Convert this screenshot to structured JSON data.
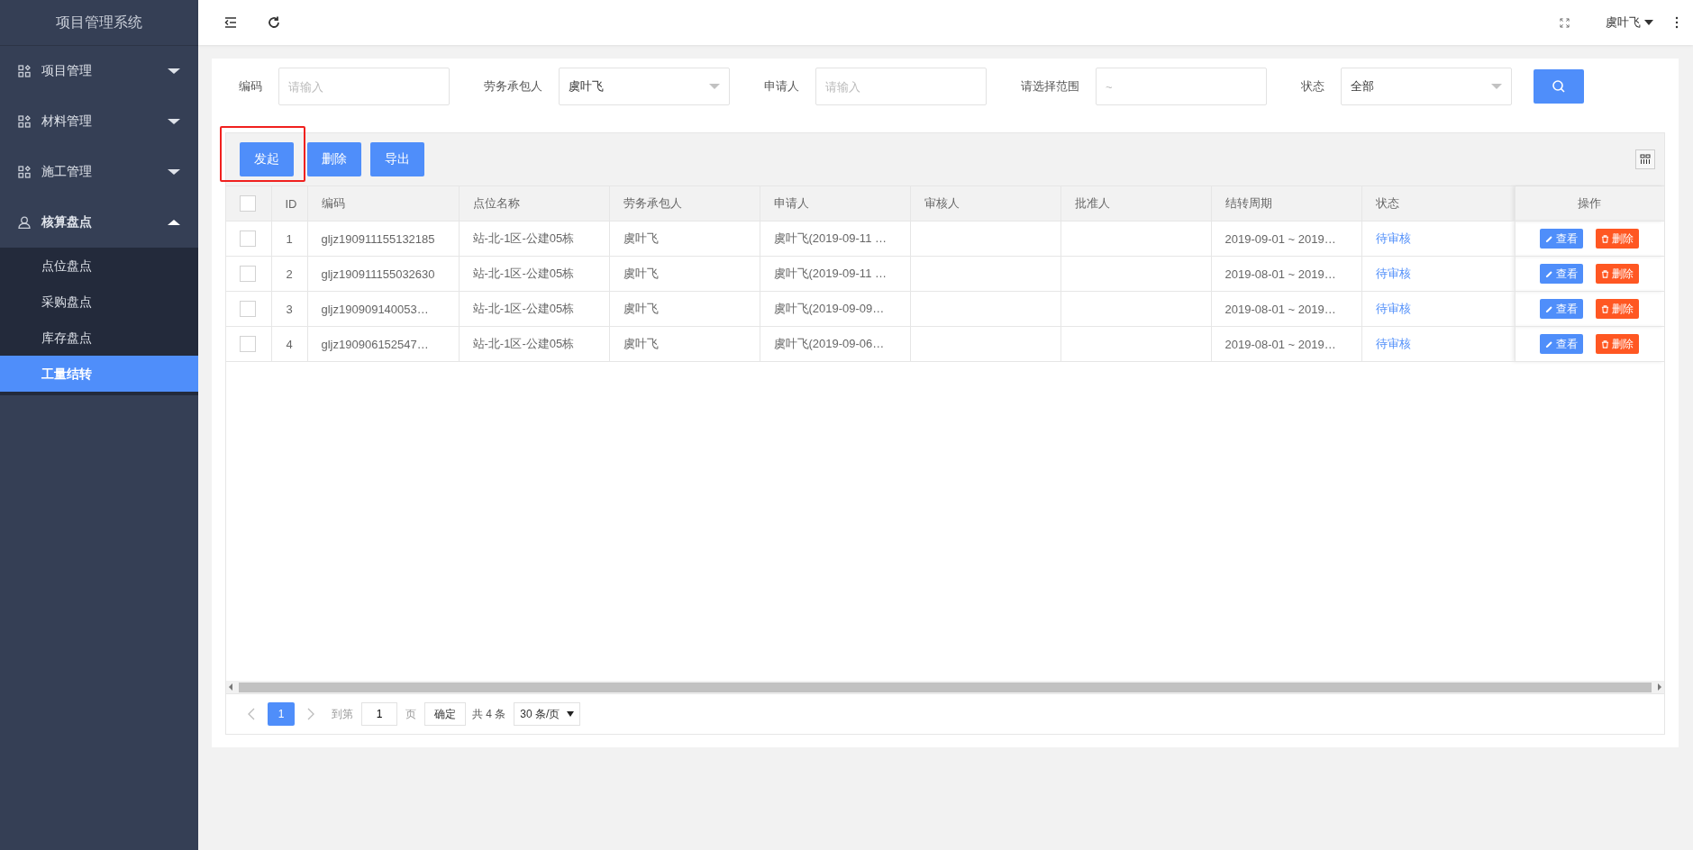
{
  "app_title": "项目管理系统",
  "sidebar": {
    "menu": [
      {
        "label": "项目管理",
        "expanded": false
      },
      {
        "label": "材料管理",
        "expanded": false
      },
      {
        "label": "施工管理",
        "expanded": false
      },
      {
        "label": "核算盘点",
        "expanded": true,
        "children": [
          {
            "label": "点位盘点",
            "selected": false
          },
          {
            "label": "采购盘点",
            "selected": false
          },
          {
            "label": "库存盘点",
            "selected": false
          },
          {
            "label": "工量结转",
            "selected": true
          }
        ]
      }
    ]
  },
  "topbar": {
    "user": "虞叶飞"
  },
  "filters": [
    {
      "kind": "input",
      "label": "编码",
      "placeholder": "请输入"
    },
    {
      "kind": "select",
      "label": "劳务承包人",
      "value": "虞叶飞"
    },
    {
      "kind": "input",
      "label": "申请人",
      "placeholder": "请输入"
    },
    {
      "kind": "input",
      "label": "请选择范围",
      "placeholder": "~"
    },
    {
      "kind": "select",
      "label": "状态",
      "value": "全部"
    }
  ],
  "toolbar": {
    "buttons": [
      {
        "label": "发起",
        "highlighted": true
      },
      {
        "label": "删除",
        "highlighted": false
      },
      {
        "label": "导出",
        "highlighted": false
      }
    ]
  },
  "table": {
    "all_checked": false,
    "columns": [
      "ID",
      "编码",
      "点位名称",
      "劳务承包人",
      "申请人",
      "审核人",
      "批准人",
      "结转周期",
      "状态",
      "操作"
    ],
    "rows": [
      {
        "checked": false,
        "id": "1",
        "code": "gljz190911155132185",
        "location": "站-北-1区-公建05栋",
        "contractor": "虞叶飞",
        "applicant": "虞叶飞(2019-09-11 …",
        "period": "2019-09-01 ~ 2019…",
        "status": "待审核",
        "actions": [
          {
            "kind": "view",
            "label": "查看"
          },
          {
            "kind": "delete",
            "label": "删除"
          }
        ]
      },
      {
        "checked": false,
        "id": "2",
        "code": "gljz190911155032630",
        "location": "站-北-1区-公建05栋",
        "contractor": "虞叶飞",
        "applicant": "虞叶飞(2019-09-11 …",
        "period": "2019-08-01 ~ 2019…",
        "status": "待审核",
        "actions": [
          {
            "kind": "view",
            "label": "查看"
          },
          {
            "kind": "delete",
            "label": "删除"
          }
        ]
      },
      {
        "checked": false,
        "id": "3",
        "code": "gljz190909140053…",
        "location": "站-北-1区-公建05栋",
        "contractor": "虞叶飞",
        "applicant": "虞叶飞(2019-09-09…",
        "period": "2019-08-01 ~ 2019…",
        "status": "待审核",
        "actions": [
          {
            "kind": "view",
            "label": "查看"
          },
          {
            "kind": "delete",
            "label": "删除"
          }
        ]
      },
      {
        "checked": false,
        "id": "4",
        "code": "gljz190906152547…",
        "location": "站-北-1区-公建05栋",
        "contractor": "虞叶飞",
        "applicant": "虞叶飞(2019-09-06…",
        "period": "2019-08-01 ~ 2019…",
        "status": "待审核",
        "actions": [
          {
            "kind": "view",
            "label": "查看"
          },
          {
            "kind": "delete",
            "label": "删除"
          }
        ]
      }
    ]
  },
  "pagination": {
    "current_page": "1",
    "goto_label": "到第",
    "goto_value": "1",
    "page_unit": "页",
    "confirm": "确定",
    "total": "共 4 条",
    "page_size": "30 条/页"
  }
}
